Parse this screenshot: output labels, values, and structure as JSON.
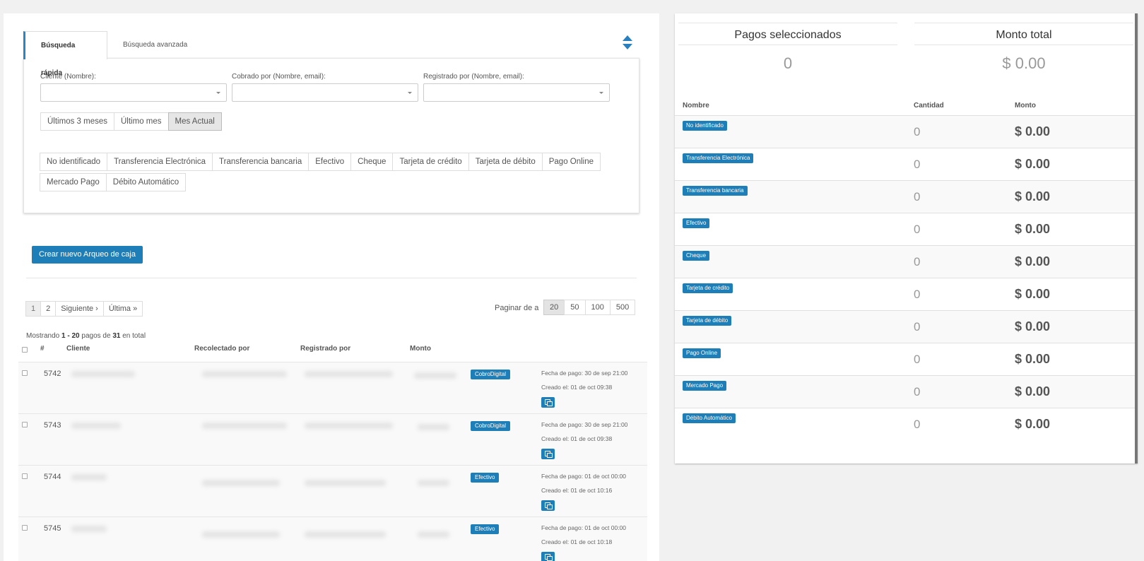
{
  "search": {
    "tabs": [
      "Búsqueda rápida",
      "Búsqueda avanzada"
    ],
    "fields": [
      {
        "label": "Cliente (Nombre):",
        "value": ""
      },
      {
        "label": "Cobrado por (Nombre, email):",
        "value": ""
      },
      {
        "label": "Registrado por (Nombre, email):",
        "value": ""
      }
    ],
    "periods": [
      "Últimos 3 meses",
      "Último mes",
      "Mes Actual"
    ],
    "active_period": "Mes Actual",
    "payment_methods_row1": [
      "No identificado",
      "Transferencia Electrónica",
      "Transferencia bancaria",
      "Efectivo",
      "Cheque",
      "Tarjeta de crédito",
      "Tarjeta de débito",
      "Pago Online"
    ],
    "payment_methods_row2": [
      "Mercado Pago",
      "Débito Automático"
    ]
  },
  "actions": {
    "create_label": "Crear nuevo Arqueo de caja"
  },
  "pagination": {
    "pages": [
      "1",
      "2",
      "Siguiente ›",
      "Última »"
    ],
    "per_page_label": "Paginar de a",
    "per_page_options": [
      "20",
      "50",
      "100",
      "500"
    ],
    "per_page_selected": "20"
  },
  "summary": {
    "showing_prefix": "Mostrando",
    "range": "1 - 20",
    "middle": "pagos de",
    "total": "31",
    "suffix": "en total"
  },
  "table": {
    "headers": [
      "#",
      "Cliente",
      "Recolectado por",
      "Registrado por",
      "Monto"
    ],
    "rows": [
      {
        "id": "5742",
        "method": "CobroDigital",
        "fecha_pago": "Fecha de pago: 30 de sep 21:00",
        "creado": "Creado el: 01 de oct 09:38"
      },
      {
        "id": "5743",
        "method": "CobroDigital",
        "fecha_pago": "Fecha de pago: 30 de sep 21:00",
        "creado": "Creado el: 01 de oct 09:38"
      },
      {
        "id": "5744",
        "method": "Efectivo",
        "fecha_pago": "Fecha de pago: 01 de oct 00:00",
        "creado": "Creado el: 01 de oct 10:16"
      },
      {
        "id": "5745",
        "method": "Efectivo",
        "fecha_pago": "Fecha de pago: 01 de oct 00:00",
        "creado": "Creado el: 01 de oct 10:18"
      }
    ]
  },
  "right": {
    "selected_title": "Pagos seleccionados",
    "selected_value": "0",
    "total_title": "Monto total",
    "total_value": "$ 0.00",
    "headers": [
      "Nombre",
      "Cantidad",
      "Monto"
    ],
    "methods": [
      {
        "name": "No identificado",
        "qty": "0",
        "amount": "$ 0.00"
      },
      {
        "name": "Transferencia Electrónica",
        "qty": "0",
        "amount": "$ 0.00"
      },
      {
        "name": "Transferencia bancaria",
        "qty": "0",
        "amount": "$ 0.00"
      },
      {
        "name": "Efectivo",
        "qty": "0",
        "amount": "$ 0.00"
      },
      {
        "name": "Cheque",
        "qty": "0",
        "amount": "$ 0.00"
      },
      {
        "name": "Tarjeta de crédito",
        "qty": "0",
        "amount": "$ 0.00"
      },
      {
        "name": "Tarjeta de débito",
        "qty": "0",
        "amount": "$ 0.00"
      },
      {
        "name": "Pago Online",
        "qty": "0",
        "amount": "$ 0.00"
      },
      {
        "name": "Mercado Pago",
        "qty": "0",
        "amount": "$ 0.00"
      },
      {
        "name": "Débito Automático",
        "qty": "0",
        "amount": "$ 0.00"
      }
    ]
  },
  "colors": {
    "accent": "#1e7fb8",
    "badge": "#1e7fb8"
  }
}
